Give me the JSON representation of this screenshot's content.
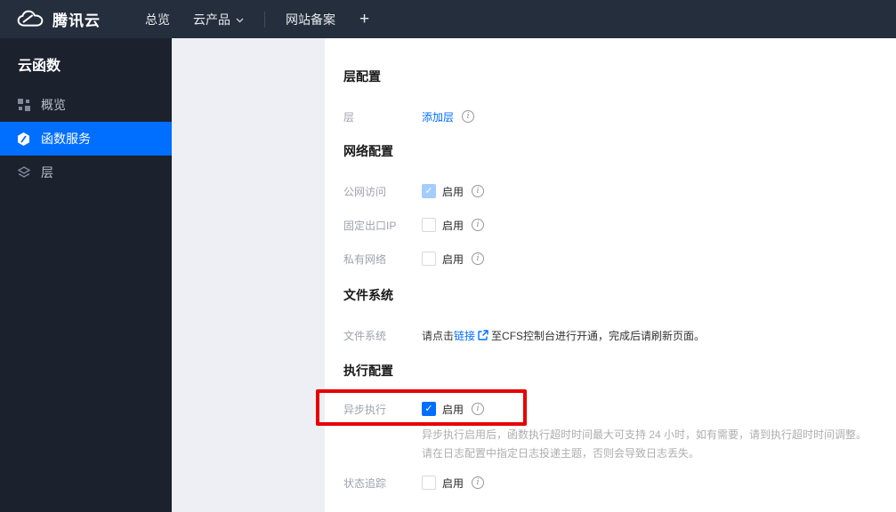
{
  "topbar": {
    "brand": "腾讯云",
    "nav": [
      {
        "label": "总览"
      },
      {
        "label": "云产品",
        "has_chevron": true
      },
      {
        "label": "网站备案"
      },
      {
        "label": "+"
      }
    ]
  },
  "sidebar": {
    "title": "云函数",
    "items": [
      {
        "label": "概览",
        "icon": "grid-overview-icon",
        "active": false
      },
      {
        "label": "函数服务",
        "icon": "scf-hexagon-icon",
        "active": true
      },
      {
        "label": "层",
        "icon": "layers-icon",
        "active": false
      }
    ]
  },
  "main": {
    "layer_config": {
      "heading": "层配置",
      "row": {
        "label": "层",
        "link": "添加层",
        "info_icon": "info-icon"
      }
    },
    "network_config": {
      "heading": "网络配置",
      "rows": [
        {
          "label": "公网访问",
          "enable": "启用",
          "checked": true,
          "disabled": true
        },
        {
          "label": "固定出口IP",
          "enable": "启用",
          "checked": false,
          "disabled": false
        },
        {
          "label": "私有网络",
          "enable": "启用",
          "checked": false,
          "disabled": false
        }
      ]
    },
    "file_system": {
      "heading": "文件系统",
      "row": {
        "label": "文件系统",
        "text_before": "请点击",
        "link": "链接",
        "text_after": "至CFS控制台进行开通，完成后请刷新页面。"
      }
    },
    "execution_config": {
      "heading": "执行配置",
      "async_row": {
        "label": "异步执行",
        "enable": "启用",
        "checked": true
      },
      "helper_line1": "异步执行启用后，函数执行超时时间最大可支持 24 小时，如有需要，请到执行超时时间调整。",
      "helper_line2": "请在日志配置中指定日志投递主题，否则会导致日志丢失。",
      "status_row": {
        "label": "状态追踪",
        "enable": "启用",
        "checked": false
      }
    }
  },
  "annotation": {
    "type": "red-rectangle",
    "target": "异步执行 启用",
    "color": "#e60000"
  },
  "colors": {
    "accent_blue": "#006eff",
    "topbar_bg": "#252e3d",
    "sidebar_bg": "#1c212e",
    "subpanel_bg": "#edeff4",
    "checked_disabled": "#a3ccff",
    "annotation_red": "#e60000"
  },
  "glyphs": {
    "check": "✓"
  }
}
